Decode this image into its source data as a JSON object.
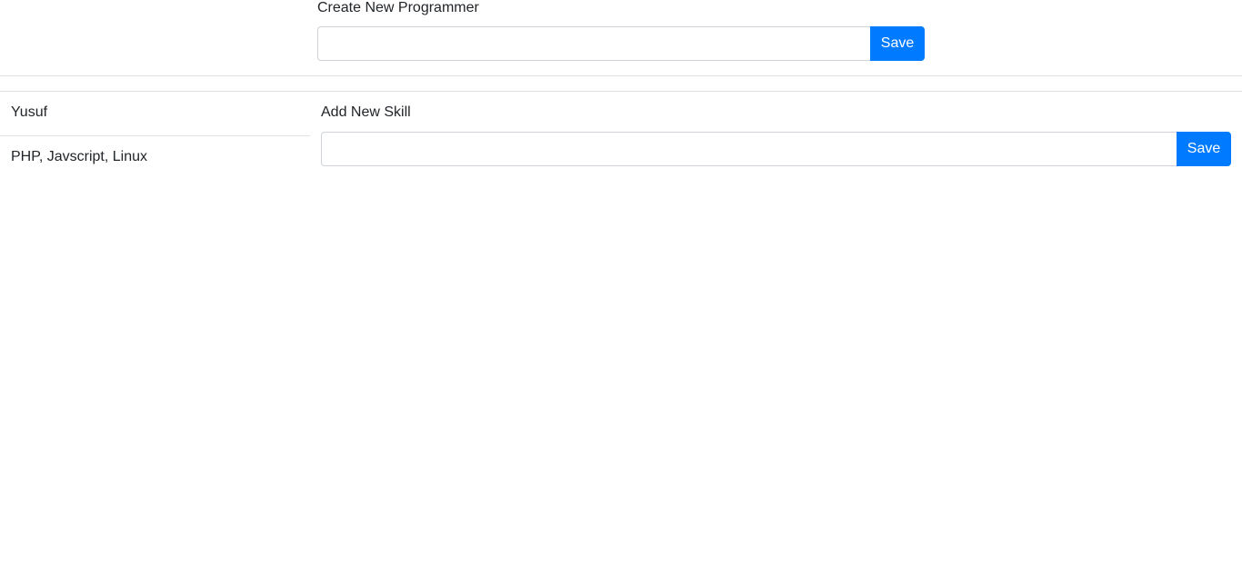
{
  "create_programmer": {
    "label": "Create New Programmer",
    "input_value": "",
    "save_label": "Save"
  },
  "programmer": {
    "name": "Yusuf",
    "skills": "PHP, Javscript, Linux"
  },
  "add_skill": {
    "label": "Add New Skill",
    "input_value": "",
    "save_label": "Save"
  },
  "colors": {
    "primary": "#007bff",
    "border": "#dee2e6",
    "input_border": "#ced4da",
    "text": "#212529"
  }
}
